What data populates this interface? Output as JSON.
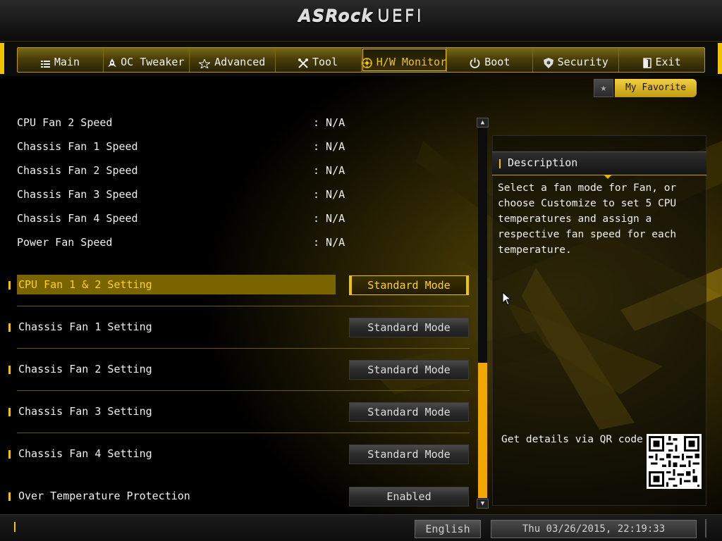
{
  "header": {
    "logo": "ASRock",
    "product": "UEFI"
  },
  "tabs": [
    {
      "label": "Main",
      "icon": "list-icon",
      "active": false
    },
    {
      "label": "OC Tweaker",
      "icon": "rocket-icon",
      "active": false
    },
    {
      "label": "Advanced",
      "icon": "star-icon",
      "active": false
    },
    {
      "label": "Tool",
      "icon": "tools-icon",
      "active": false
    },
    {
      "label": "H/W Monitor",
      "icon": "monitor-icon",
      "active": true
    },
    {
      "label": "Boot",
      "icon": "power-icon",
      "active": false
    },
    {
      "label": "Security",
      "icon": "shield-icon",
      "active": false
    },
    {
      "label": "Exit",
      "icon": "exit-door-icon",
      "active": false
    }
  ],
  "favorite": {
    "label": "My Favorite",
    "icon": "star-icon"
  },
  "info_rows": [
    {
      "label": "CPU Fan 2 Speed",
      "value": ": N/A"
    },
    {
      "label": "Chassis Fan 1 Speed",
      "value": ": N/A"
    },
    {
      "label": "Chassis Fan 2 Speed",
      "value": ": N/A"
    },
    {
      "label": "Chassis Fan 3 Speed",
      "value": ": N/A"
    },
    {
      "label": "Chassis Fan 4 Speed",
      "value": ": N/A"
    },
    {
      "label": "Power Fan Speed",
      "value": ": N/A"
    }
  ],
  "settings": [
    {
      "label": "CPU Fan 1 & 2 Setting",
      "value": "Standard Mode",
      "selected": true
    },
    {
      "label": "Chassis Fan 1 Setting",
      "value": "Standard Mode",
      "selected": false
    },
    {
      "label": "Chassis Fan 2 Setting",
      "value": "Standard Mode",
      "selected": false
    },
    {
      "label": "Chassis Fan 3 Setting",
      "value": "Standard Mode",
      "selected": false
    },
    {
      "label": "Chassis Fan 4 Setting",
      "value": "Standard Mode",
      "selected": false
    },
    {
      "label": "Over Temperature Protection",
      "value": "Enabled",
      "selected": false
    }
  ],
  "description": {
    "title": "Description",
    "text": "Select a fan mode for Fan, or\nchoose Customize to set 5 CPU\ntemperatures and assign a\nrespective fan speed for each\ntemperature.",
    "qr_label": "Get details via QR code"
  },
  "footer": {
    "language": "English",
    "datetime": "Thu 03/26/2015, 22:19:33"
  },
  "colors": {
    "accent": "#f0c400",
    "selected_bg": "#7a6400",
    "selected_text": "#ffd21a",
    "scrollbar": "#f0a800"
  }
}
